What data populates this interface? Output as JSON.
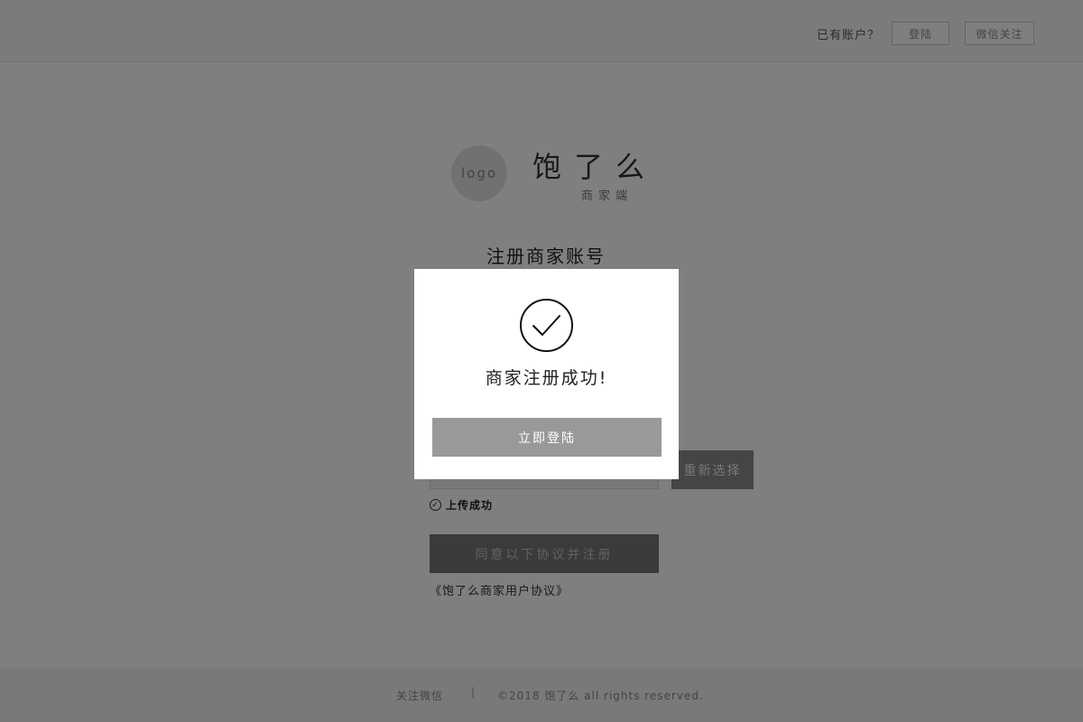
{
  "header": {
    "account_prompt": "已有账户？",
    "login_label": "登陆",
    "wechat_label": "微信关注"
  },
  "brand": {
    "logo_text": "logo",
    "name": "饱了么",
    "subtitle": "商家端"
  },
  "form": {
    "title": "注册商家账号",
    "reselect_label": "重新选择",
    "upload_status": "上传成功",
    "submit_label": "同意以下协议并注册",
    "agreement_link": "《饱了么商家用户协议》"
  },
  "footer": {
    "follow_label": "关注微信",
    "separator": "|",
    "copyright": "©2018 饱了么 all rights reserved."
  },
  "modal": {
    "icon": "check-circle-icon",
    "message": "商家注册成功!",
    "button_label": "立即登陆"
  }
}
